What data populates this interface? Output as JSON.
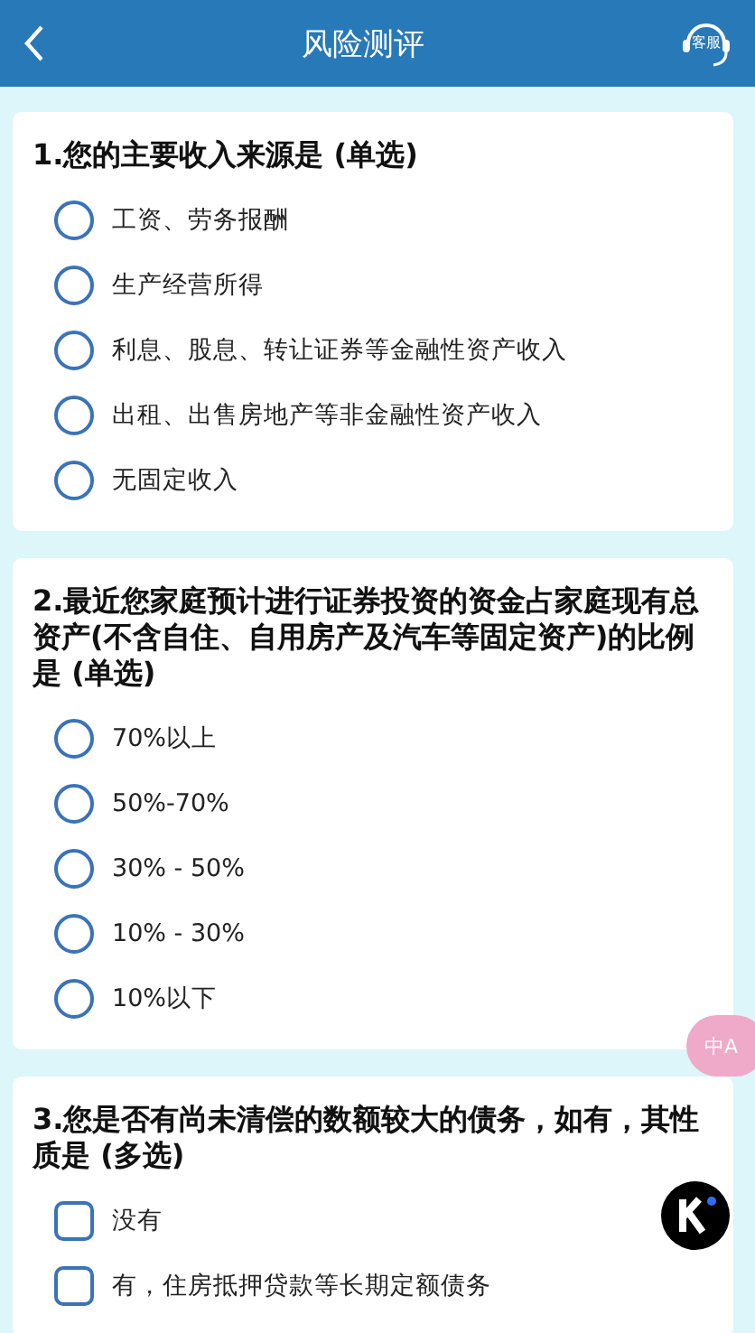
{
  "header": {
    "title": "风险测评",
    "service_label": "客服"
  },
  "questions": [
    {
      "title": "1.您的主要收入来源是 (单选)",
      "kind": "radio",
      "options": [
        {
          "label": "工资、劳务报酬",
          "selected": false
        },
        {
          "label": "生产经营所得",
          "selected": false
        },
        {
          "label": "利息、股息、转让证券等金融性资产收入",
          "selected": false
        },
        {
          "label": "出租、出售房地产等非金融性资产收入",
          "selected": false
        },
        {
          "label": "无固定收入",
          "selected": false
        }
      ]
    },
    {
      "title": "2.最近您家庭预计进行证券投资的资金占家庭现有总资产(不含自住、自用房产及汽车等固定资产)的比例是 (单选)",
      "kind": "radio",
      "options": [
        {
          "label": "70%以上",
          "selected": false
        },
        {
          "label": "50%-70%",
          "selected": false
        },
        {
          "label": "30% - 50%",
          "selected": false
        },
        {
          "label": "10% - 30%",
          "selected": false
        },
        {
          "label": "10%以下",
          "selected": false
        }
      ]
    },
    {
      "title": "3.您是否有尚未清偿的数额较大的债务，如有，其性质是 (多选)",
      "kind": "checkbox",
      "options": [
        {
          "label": "没有",
          "selected": false
        },
        {
          "label": "有，住房抵押贷款等长期定额债务",
          "selected": false
        }
      ]
    }
  ],
  "translate_button": {
    "label": "中A"
  }
}
